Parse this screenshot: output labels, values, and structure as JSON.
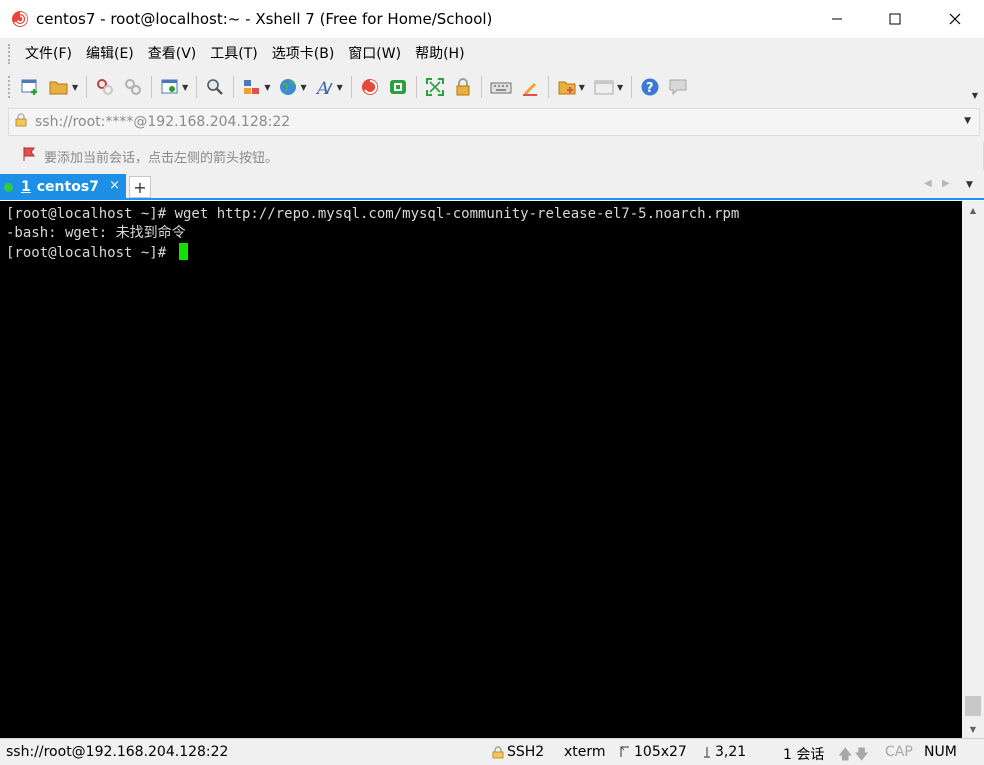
{
  "window": {
    "title": "centos7 - root@localhost:~ - Xshell 7 (Free for Home/School)"
  },
  "menu": {
    "items": [
      "文件(F)",
      "编辑(E)",
      "查看(V)",
      "工具(T)",
      "选项卡(B)",
      "窗口(W)",
      "帮助(H)"
    ]
  },
  "address": {
    "value": "ssh://root:****@192.168.204.128:22"
  },
  "hint": {
    "text": "要添加当前会话，点击左侧的箭头按钮。"
  },
  "tabs": {
    "active": {
      "number": "1",
      "label": "centos7"
    },
    "close_glyph": "×",
    "add_glyph": "+"
  },
  "terminal": {
    "lines": [
      "[root@localhost ~]# wget http://repo.mysql.com/mysql-community-release-el7-5.noarch.rpm",
      "-bash: wget: 未找到命令",
      "[root@localhost ~]# "
    ],
    "cursor_color": "#12e000"
  },
  "status": {
    "connection": "ssh://root@192.168.204.128:22",
    "protocol": "SSH2",
    "term_type": "xterm",
    "size": "105x27",
    "position": "3,21",
    "sessions": "1 会话",
    "caps": "CAP",
    "num": "NUM"
  },
  "colors": {
    "tab_active": "#1e8fe6",
    "tab_dot": "#2ecc40",
    "terminal_bg": "#000000",
    "terminal_fg": "#d8d8d8"
  },
  "icons": {
    "app": "xshell-shell-icon",
    "toolbar": [
      "new-session-icon",
      "open-folder-icon",
      "reconnect-icon",
      "disconnect-icon",
      "properties-icon",
      "find-icon",
      "transfer-icon",
      "globe-icon",
      "font-icon",
      "xshell-icon",
      "xftp-icon",
      "fullscreen-icon",
      "lock-icon",
      "keyboard-icon",
      "highlight-icon",
      "compose-icon",
      "layout-icon",
      "help-icon",
      "chat-icon"
    ]
  }
}
